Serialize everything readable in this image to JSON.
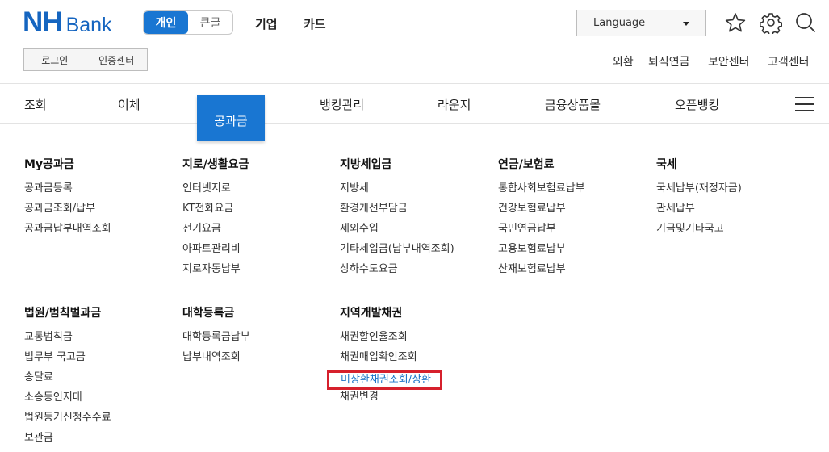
{
  "brand": {
    "nh": "NH",
    "bank": "Bank"
  },
  "customer_toggle": {
    "personal": "개인",
    "large_font": "큰글"
  },
  "top_links": [
    "기업",
    "카드"
  ],
  "language": {
    "label": "Language"
  },
  "header_icons": [
    "star-icon",
    "gear-icon",
    "search-icon"
  ],
  "auth": {
    "login": "로그인",
    "cert_center": "인증센터"
  },
  "util_links": [
    "외환",
    "퇴직연금",
    "보안센터",
    "고객센터"
  ],
  "gnb": {
    "items": [
      "조회",
      "이체",
      "공과금",
      "뱅킹관리",
      "라운지",
      "금융상품몰",
      "오픈뱅킹"
    ],
    "active_index": 2
  },
  "menu": {
    "columns": [
      {
        "title": "My공과금",
        "items": [
          "공과금등록",
          "공과금조회/납부",
          "공과금납부내역조회"
        ]
      },
      {
        "title": "지로/생활요금",
        "items": [
          "인터넷지로",
          "KT전화요금",
          "전기요금",
          "아파트관리비",
          "지로자동납부"
        ]
      },
      {
        "title": "지방세입금",
        "items": [
          "지방세",
          "환경개선부담금",
          "세외수입",
          "기타세입금(납부내역조회)",
          "상하수도요금"
        ]
      },
      {
        "title": "연금/보험료",
        "items": [
          "통합사회보험료납부",
          "건강보험료납부",
          "국민연금납부",
          "고용보험료납부",
          "산재보험료납부"
        ]
      },
      {
        "title": "국세",
        "items": [
          "국세납부(재정자금)",
          "관세납부",
          "기금및기타국고"
        ]
      },
      {
        "title": "법원/범칙벌과금",
        "items": [
          "교통범칙금",
          "법무부 국고금",
          "송달료",
          "소송등인지대",
          "법원등기신청수수료",
          "보관금"
        ]
      },
      {
        "title": "대학등록금",
        "items": [
          "대학등록금납부",
          "납부내역조회"
        ]
      },
      {
        "title": "지역개발채권",
        "items": [
          "채권할인율조회",
          "채권매입확인조회",
          "미상환채권조회/상환",
          "채권변경"
        ]
      }
    ],
    "highlighted": "미상환채권조회/상환"
  },
  "colors": {
    "brand_blue": "#1565c0",
    "active_blue": "#1976d2",
    "highlight_red": "#d6202c"
  }
}
